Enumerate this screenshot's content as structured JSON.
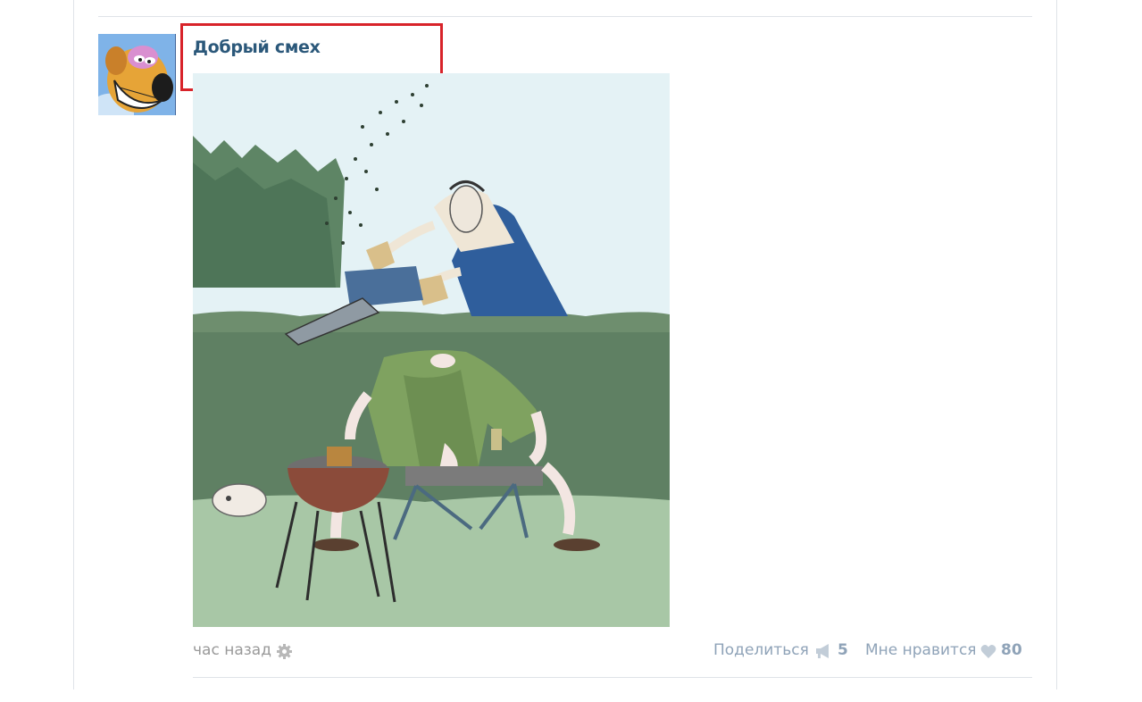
{
  "post": {
    "author_name": "Добрый смех",
    "time": "час назад",
    "image_alt": "cartoon",
    "share": {
      "label": "Поделиться",
      "count": "5"
    },
    "like": {
      "label": "Мне нравится",
      "count": "80"
    }
  },
  "icons": {
    "settings": "gear-icon",
    "share": "megaphone-icon",
    "like": "heart-icon"
  },
  "colors": {
    "link": "#2b587a",
    "muted_link": "#8fa3b8",
    "muted_text": "#999999",
    "highlight": "#d8232a",
    "divider": "#dfe3e8"
  }
}
